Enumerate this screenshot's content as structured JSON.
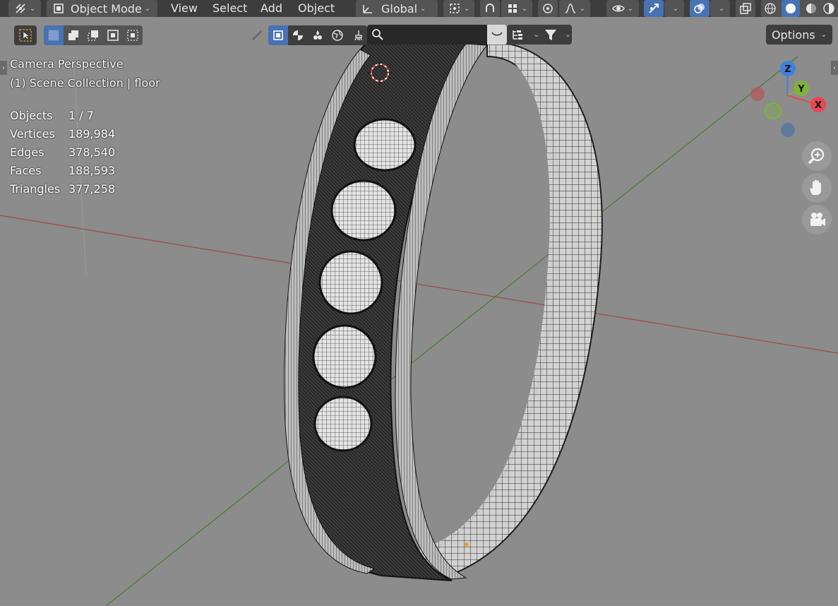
{
  "header": {
    "mode_label": "Object Mode",
    "menus": [
      "View",
      "Select",
      "Add",
      "Object"
    ],
    "transform_orientation": "Global"
  },
  "toolbar": {
    "search_placeholder": "",
    "options_label": "Options"
  },
  "overlay": {
    "view_name": "Camera Perspective",
    "collection": "(1) Scene Collection | floor",
    "stats": [
      {
        "label": "Objects",
        "value": "1 / 7"
      },
      {
        "label": "Vertices",
        "value": "189,984"
      },
      {
        "label": "Edges",
        "value": "378,540"
      },
      {
        "label": "Faces",
        "value": "188,593"
      },
      {
        "label": "Triangles",
        "value": "377,258"
      }
    ]
  },
  "gizmo": {
    "x_label": "X",
    "y_label": "Y",
    "z_label": "Z",
    "colors": {
      "x": "#e8464f",
      "y": "#7fb33b",
      "z": "#3f82de"
    }
  },
  "icons": [
    "editor-type-icon",
    "object-mode-icon",
    "transform-orientation-icon",
    "pivot-icon",
    "snap-icon",
    "snap-increment-icon",
    "proportional-edit-icon",
    "falloff-icon",
    "visibility-icon",
    "gizmo-icon",
    "overlay-icon",
    "xray-icon",
    "wireframe-shading-icon",
    "solid-shading-icon",
    "material-shading-icon",
    "rendered-shading-icon",
    "select-tool-icon",
    "zoom-icon",
    "hand-pan-icon",
    "camera-icon",
    "search-icon",
    "filter-icon"
  ]
}
